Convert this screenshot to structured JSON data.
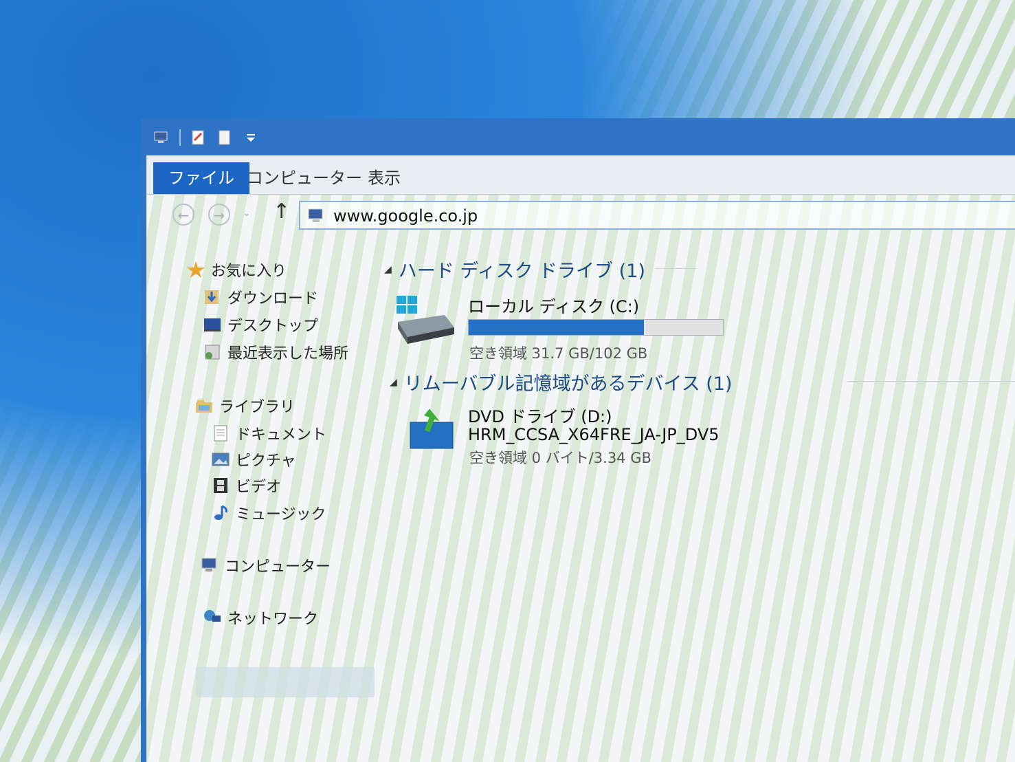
{
  "window": {
    "tabs": [
      {
        "label": "ファイル",
        "active": true
      },
      {
        "label": "コンピューター",
        "active": false
      },
      {
        "label": "表示",
        "active": false
      }
    ],
    "address": "www.google.co.jp"
  },
  "sidebar": {
    "favorites": {
      "label": "お気に入り",
      "items": [
        "ダウンロード",
        "デスクトップ",
        "最近表示した場所"
      ]
    },
    "libraries": {
      "label": "ライブラリ",
      "items": [
        "ドキュメント",
        "ピクチャ",
        "ビデオ",
        "ミュージック"
      ]
    },
    "computer": "コンピューター",
    "network": "ネットワーク"
  },
  "content": {
    "hdd_group": "ハード ディスク ドライブ (1)",
    "local_disk": {
      "name": "ローカル ディスク (C:)",
      "free_text": "空き領域 31.7 GB/102 GB",
      "used_fraction": 0.69
    },
    "removable_group": "リムーバブル記憶域があるデバイス (1)",
    "dvd": {
      "name": "DVD ドライブ (D:)",
      "label": "HRM_CCSA_X64FRE_JA-JP_DV5",
      "free_text": "空き領域 0 バイト/3.34 GB"
    }
  },
  "colors": {
    "titlebar": "#2e73c6",
    "active_tab": "#1e66c4",
    "usage_bar": "#2571c5",
    "group_header": "#1d4b86"
  }
}
